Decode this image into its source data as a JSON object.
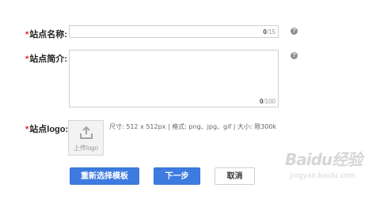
{
  "form": {
    "required_mark": "*",
    "site_name": {
      "label": "站点名称:",
      "value": "",
      "counter_current": "0",
      "counter_max": "/15",
      "help": "?"
    },
    "site_intro": {
      "label": "站点简介:",
      "value": "",
      "counter_current": "0",
      "counter_max": "/100",
      "help": "?"
    },
    "site_logo": {
      "label": "站点logo:",
      "upload_text": "上传logo",
      "info": "尺寸: 512 x 512px | 格式: png、jpg、gif | 大小: 限300k"
    }
  },
  "buttons": {
    "reselect_template": "重新选择模板",
    "next_step": "下一步",
    "cancel": "取消"
  },
  "watermark": {
    "logo_text": "Baidu经验",
    "sub_text": "jingyan.baidu.com"
  },
  "colors": {
    "primary": "#3e7be0",
    "required": "#e0251b"
  }
}
